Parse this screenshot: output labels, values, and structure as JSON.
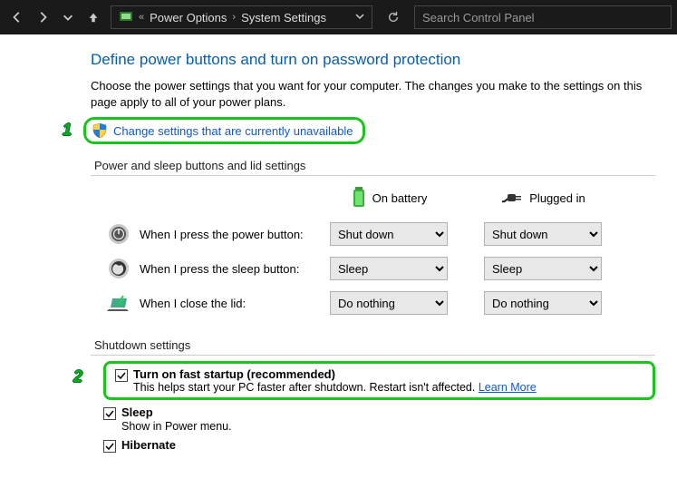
{
  "nav": {
    "breadcrumb_prefix": "«",
    "crumb1": "Power Options",
    "crumb2": "System Settings",
    "search_placeholder": "Search Control Panel"
  },
  "page": {
    "title": "Define power buttons and turn on password protection",
    "intro": "Choose the power settings that you want for your computer. The changes you make to the settings on this page apply to all of your power plans.",
    "change_link": "Change settings that are currently unavailable"
  },
  "section1": {
    "header": "Power and sleep buttons and lid settings",
    "col_battery": "On battery",
    "col_plugged": "Plugged in",
    "rows": [
      {
        "label": "When I press the power button:",
        "battery": "Shut down",
        "plugged": "Shut down"
      },
      {
        "label": "When I press the sleep button:",
        "battery": "Sleep",
        "plugged": "Sleep"
      },
      {
        "label": "When I close the lid:",
        "battery": "Do nothing",
        "plugged": "Do nothing"
      }
    ]
  },
  "section2": {
    "header": "Shutdown settings",
    "fast": {
      "title": "Turn on fast startup (recommended)",
      "desc": "This helps start your PC faster after shutdown. Restart isn't affected. ",
      "learn": "Learn More"
    },
    "sleep": {
      "title": "Sleep",
      "desc": "Show in Power menu."
    },
    "hibernate": {
      "title": "Hibernate"
    }
  },
  "markers": {
    "one": "1",
    "two": "2"
  }
}
